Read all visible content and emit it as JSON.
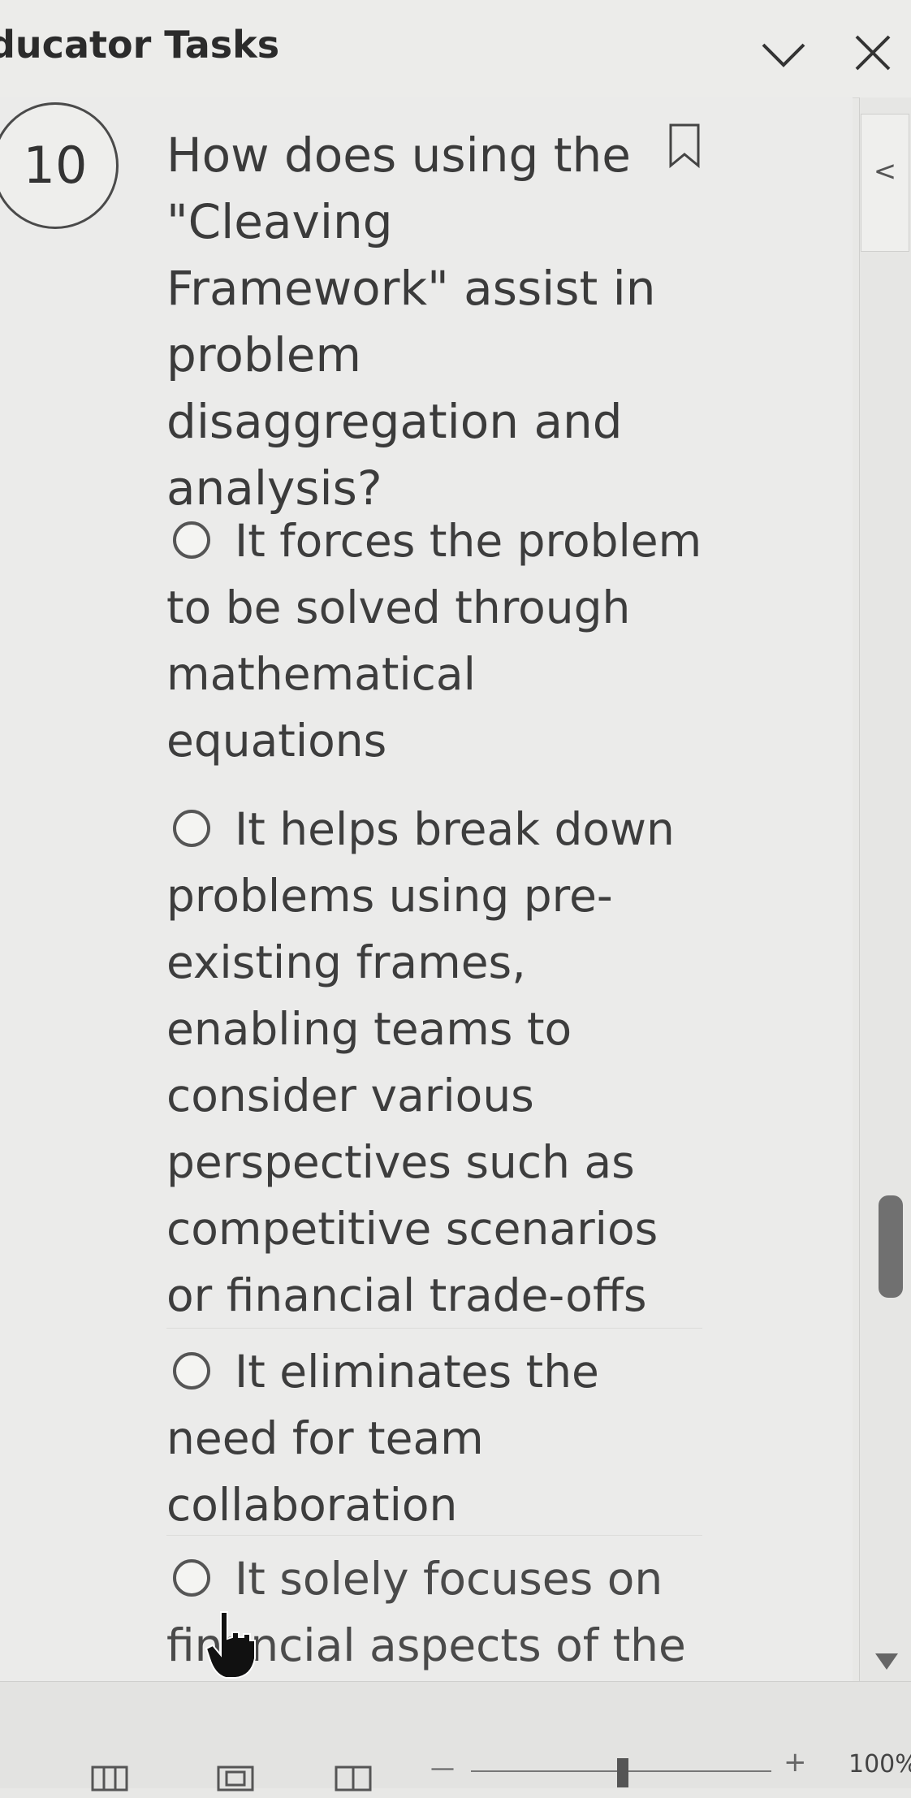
{
  "header": {
    "title": "ducator Tasks",
    "collapse_icon": "chevron-down-icon",
    "close_icon": "close-icon"
  },
  "question": {
    "number": "10",
    "text": "How does using the \"Cleaving Framework\" assist in problem disaggregation and analysis?",
    "bookmark_icon": "bookmark-icon",
    "options": [
      {
        "label": "It forces the problem to be solved through mathematical equations"
      },
      {
        "label": "It helps break down problems using pre-existing frames, enabling teams to consider various perspectives such as competitive scenarios or financial trade-offs"
      },
      {
        "label": "It eliminates the need for team collaboration"
      },
      {
        "label": "It solely focuses on financial aspects of the problem"
      }
    ]
  },
  "side_panel": {
    "toggle_label": "<"
  },
  "status_bar": {
    "zoom_minus": "—",
    "zoom_plus": "+",
    "zoom_level": "100%"
  }
}
